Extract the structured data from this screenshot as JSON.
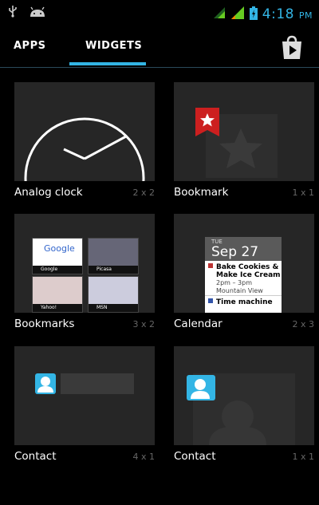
{
  "status_bar": {
    "time": "4:18",
    "ampm": "PM",
    "icons": [
      "usb-icon",
      "android-debug-icon",
      "wifi-icon",
      "signal-icon",
      "battery-icon"
    ],
    "accent": "#33b5e5"
  },
  "tabs": [
    {
      "label": "APPS",
      "selected": false
    },
    {
      "label": "WIDGETS",
      "selected": true
    }
  ],
  "store_icon": "play-store-icon",
  "widgets": [
    {
      "name": "Analog clock",
      "size": "2 x 2"
    },
    {
      "name": "Bookmark",
      "size": "1 x 1"
    },
    {
      "name": "Bookmarks",
      "size": "3 x 2"
    },
    {
      "name": "Calendar",
      "size": "2 x 3"
    },
    {
      "name": "Contact",
      "size": "4 x 1"
    },
    {
      "name": "Contact",
      "size": "1 x 1"
    }
  ],
  "bookmarks_preview": [
    "Google",
    "Picasa",
    "Yahoo!",
    "MSN"
  ],
  "calendar_preview": {
    "dow": "TUE",
    "date": "Sep 27",
    "events": [
      {
        "title": "Bake Cookies & Make Ice Cream",
        "time": "2pm – 3pm",
        "place": "Mountain View"
      },
      {
        "title": "Time machine",
        "time": "",
        "place": ""
      }
    ]
  }
}
